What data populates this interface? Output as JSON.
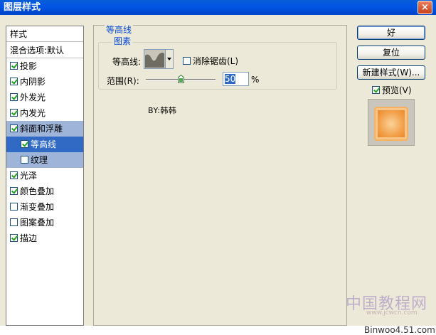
{
  "window": {
    "title": "图层样式",
    "close_label": "×"
  },
  "style_list": {
    "header": "样式",
    "blend_options": "混合选项:默认",
    "items": [
      {
        "label": "投影",
        "checked": true
      },
      {
        "label": "内阴影",
        "checked": true
      },
      {
        "label": "外发光",
        "checked": true
      },
      {
        "label": "内发光",
        "checked": true
      },
      {
        "label": "斜面和浮雕",
        "checked": true
      },
      {
        "label": "等高线",
        "checked": true
      },
      {
        "label": "纹理",
        "checked": false
      },
      {
        "label": "光泽",
        "checked": true
      },
      {
        "label": "颜色叠加",
        "checked": true
      },
      {
        "label": "渐变叠加",
        "checked": false
      },
      {
        "label": "图案叠加",
        "checked": false
      },
      {
        "label": "描边",
        "checked": true
      }
    ]
  },
  "contour_panel": {
    "section_title": "等高线",
    "group_title": "图素",
    "contour_label": "等高线:",
    "antialias_label": "消除锯齿(L)",
    "antialias_checked": false,
    "range_label": "范围(R):",
    "range_value": "50",
    "range_unit": "%",
    "signature": "BY:韩韩"
  },
  "buttons": {
    "ok": "好",
    "reset": "复位",
    "new_style": "新建样式(W)...",
    "preview_label": "预览(V)",
    "preview_checked": true
  },
  "watermark": {
    "text": "中国教程网",
    "url": "www.jcwcn.com",
    "site": "Binwoo4.51.com"
  },
  "colors": {
    "title_bar": "#0054e3",
    "selection": "#316ac5",
    "preview_orange": "#f3a04a"
  }
}
